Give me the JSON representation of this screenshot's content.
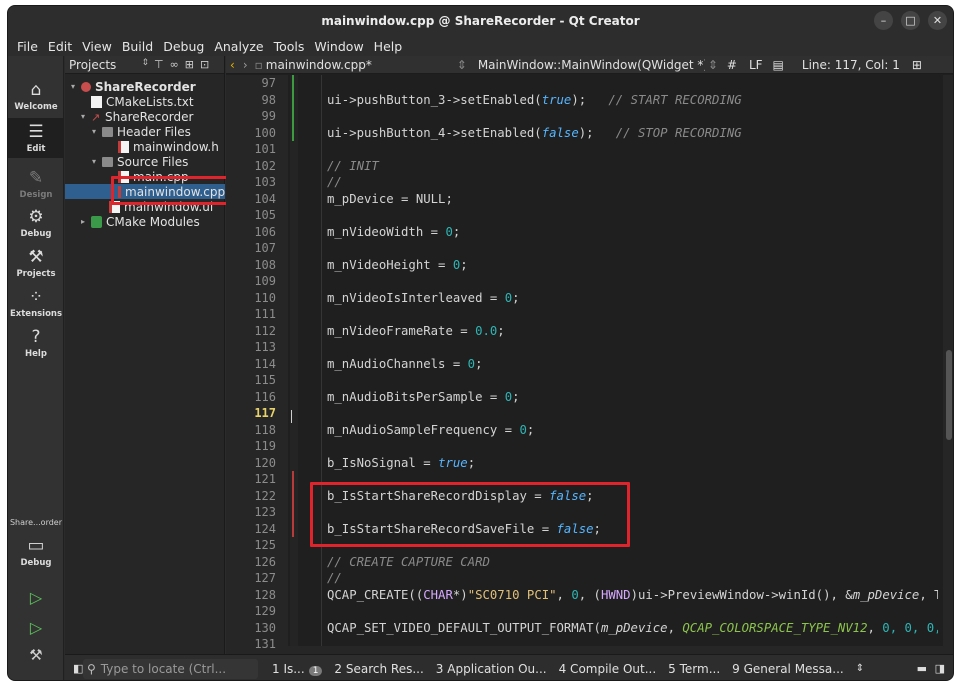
{
  "window": {
    "title": "mainwindow.cpp @ ShareRecorder - Qt Creator"
  },
  "menu": [
    "File",
    "Edit",
    "View",
    "Build",
    "Debug",
    "Analyze",
    "Tools",
    "Window",
    "Help"
  ],
  "modes": [
    {
      "label": "Welcome",
      "icon": "⌂"
    },
    {
      "label": "Edit",
      "icon": "☰"
    },
    {
      "label": "Design",
      "icon": "✎"
    },
    {
      "label": "Debug",
      "icon": "⚙"
    },
    {
      "label": "Projects",
      "icon": "⚒"
    },
    {
      "label": "Extensions",
      "icon": "⁘"
    },
    {
      "label": "Help",
      "icon": "?"
    }
  ],
  "kit": {
    "name": "Share...order",
    "mode": "Debug"
  },
  "projects": {
    "selector": "Projects",
    "tree": [
      {
        "label": "ShareRecorder",
        "icon": "proj"
      },
      {
        "label": "CMakeLists.txt",
        "icon": "txt"
      },
      {
        "label": "ShareRecorder",
        "icon": "target"
      },
      {
        "label": "Header Files",
        "icon": "folder"
      },
      {
        "label": "mainwindow.h",
        "icon": "h"
      },
      {
        "label": "Source Files",
        "icon": "folder"
      },
      {
        "label": "main.cpp",
        "icon": "cpp"
      },
      {
        "label": "mainwindow.cpp",
        "icon": "cpp"
      },
      {
        "label": "mainwindow.ui",
        "icon": "ui"
      },
      {
        "label": "CMake Modules",
        "icon": "cmake"
      }
    ]
  },
  "editor": {
    "file": "mainwindow.cpp*",
    "symbol": "MainWindow::MainWindow(QWidget *)",
    "hash": "#",
    "eol": "LF",
    "position": "Line: 117, Col: 1",
    "current_line": "117",
    "line_numbers": [
      "97",
      "98",
      "99",
      "100",
      "101",
      "102",
      "103",
      "104",
      "105",
      "106",
      "107",
      "108",
      "109",
      "110",
      "111",
      "112",
      "113",
      "114",
      "115",
      "116",
      "117",
      "118",
      "119",
      "120",
      "121",
      "122",
      "123",
      "124",
      "125",
      "126",
      "127",
      "128",
      "129",
      "130",
      "131"
    ],
    "lines": {
      "l98_a": "ui->pushButton_3->setEnabled(",
      "l98_kw": "true",
      "l98_b": ");   ",
      "l98_cm": "// START RECORDING",
      "l100_a": "ui->pushButton_4->setEnabled(",
      "l100_kw": "false",
      "l100_b": ");   ",
      "l100_cm": "// STOP RECORDING",
      "l102": "// INIT",
      "l103": "//",
      "l104": "m_pDevice = NULL;",
      "l106_a": "m_nVideoWidth = ",
      "l106_n": "0",
      "l108_a": "m_nVideoHeight = ",
      "l108_n": "0",
      "l110_a": "m_nVideoIsInterleaved = ",
      "l110_n": "0",
      "l112_a": "m_nVideoFrameRate = ",
      "l112_n": "0.0",
      "l114_a": "m_nAudioChannels = ",
      "l114_n": "0",
      "l116_a": "m_nAudioBitsPerSample = ",
      "l116_n": "0",
      "l118_a": "m_nAudioSampleFrequency = ",
      "l118_n": "0",
      "l120_a": "b_IsNoSignal = ",
      "l120_kw": "true",
      "l122_a": "b_IsStartShareRecordDisplay = ",
      "l122_kw": "false",
      "l124_a": "b_IsStartShareRecordSaveFile = ",
      "l124_kw": "false",
      "semi": ";",
      "l126": "// CREATE CAPTURE CARD",
      "l127": "//",
      "l128_a": "QCAP_CREATE((",
      "l128_type": "CHAR",
      "l128_b": "*)",
      "l128_str": "\"SC0710 PCI\"",
      "l128_c": ", ",
      "l128_n": "0",
      "l128_d": ", (",
      "l128_type2": "HWND",
      "l128_e": ")ui->PreviewWindow->winId(), &",
      "l128_f": "m_pDevice",
      "l128_g": ", T",
      "l130_a": "QCAP_SET_VIDEO_DEFAULT_OUTPUT_FORMAT(",
      "l130_b": "m_pDevice",
      "l130_c": ", ",
      "l130_enum": "QCAP_COLORSPACE_TYPE_NV12",
      "l130_d": ", ",
      "l130_n": "0, 0, 0,"
    }
  },
  "status": {
    "locate_placeholder": "Type to locate (Ctrl...",
    "tabs": [
      "1 Is...",
      "2 Search Res...",
      "3 Application Ou...",
      "4 Compile Out...",
      "5 Term...",
      "9 General Messa..."
    ],
    "issues_count": "1"
  },
  "colors": {
    "highlight": "#e0242c",
    "selection": "#2e5f8f"
  }
}
